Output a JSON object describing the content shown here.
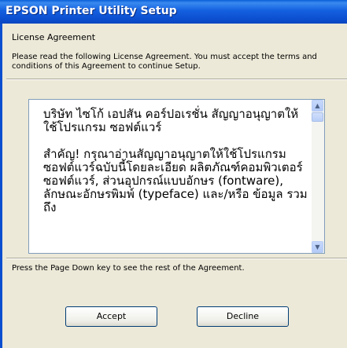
{
  "window": {
    "title": "EPSON Printer Utility Setup"
  },
  "page": {
    "section_title": "License Agreement",
    "instructions": "Please read the following License Agreement. You must accept the terms and conditions of this Agreement to continue Setup.",
    "license_paragraphs": [
      "บริษัท ไซโก้ เอปสัน คอร์ปอเรชั่น สัญญาอนุญาตให้ใช้โปรแกรม ซอฟต์แวร์",
      "สำคัญ! กรุณาอ่านสัญญาอนุญาตให้ใช้โปรแกรมซอฟต์แวร์ฉบับนี้โดยละเอียด ผลิตภัณฑ์คอมพิวเตอร์ ซอฟต์แวร์, ส่วนอุปกรณ์แบบอักษร (fontware), ลักษณะอักษรพิมพ์ (typeface) และ/หรือ ข้อมูล รวมถึง"
    ],
    "pagedown_hint": "Press the Page Down key to see the rest of the Agreement."
  },
  "buttons": {
    "accept": "Accept",
    "decline": "Decline"
  },
  "icons": {
    "scroll_up": "scroll-up-arrow",
    "scroll_down": "scroll-down-arrow"
  },
  "colors": {
    "titlebar": "#0c54d6",
    "dialog_bg": "#ece9d8"
  }
}
